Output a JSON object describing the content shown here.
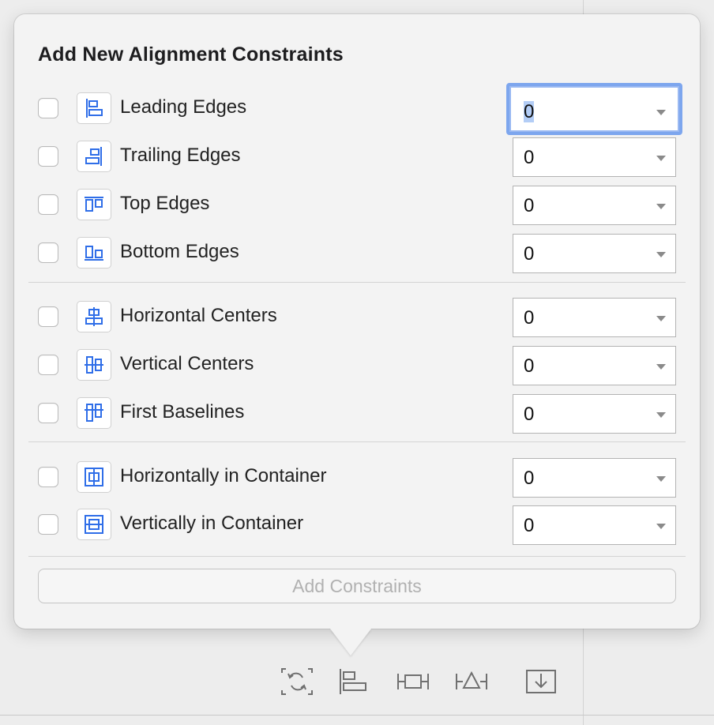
{
  "popover": {
    "title": "Add New Alignment Constraints",
    "add_button": "Add Constraints"
  },
  "constraints": [
    {
      "label": "Leading Edges",
      "value": "0",
      "icon": "leading-edges-icon",
      "focused": true
    },
    {
      "label": "Trailing Edges",
      "value": "0",
      "icon": "trailing-edges-icon"
    },
    {
      "label": "Top Edges",
      "value": "0",
      "icon": "top-edges-icon"
    },
    {
      "label": "Bottom Edges",
      "value": "0",
      "icon": "bottom-edges-icon"
    },
    {
      "label": "Horizontal Centers",
      "value": "0",
      "icon": "horizontal-centers-icon"
    },
    {
      "label": "Vertical Centers",
      "value": "0",
      "icon": "vertical-centers-icon"
    },
    {
      "label": "First Baselines",
      "value": "0",
      "icon": "first-baselines-icon"
    },
    {
      "label": "Horizontally in Container",
      "value": "0",
      "icon": "horizontally-in-container-icon"
    },
    {
      "label": "Vertically in Container",
      "value": "0",
      "icon": "vertically-in-container-icon"
    }
  ],
  "toolbar": {
    "icons": [
      "update-frames-icon",
      "align-icon",
      "add-constraints-icon",
      "resolve-issues-icon",
      "embed-in-icon"
    ]
  },
  "colors": {
    "accent_blue": "#2f6ee8",
    "focus_ring": "#7da6ee"
  }
}
